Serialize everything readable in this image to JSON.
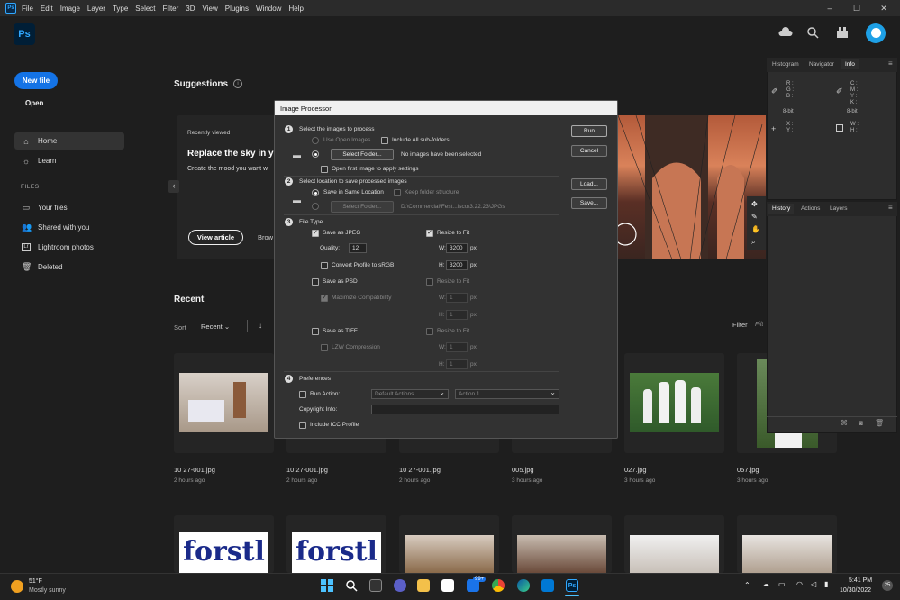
{
  "menubar": {
    "app_icon": "Ps",
    "items": [
      "File",
      "Edit",
      "Image",
      "Layer",
      "Type",
      "Select",
      "Filter",
      "3D",
      "View",
      "Plugins",
      "Window",
      "Help"
    ],
    "minimize": "–",
    "maximize": "☐",
    "close": "✕"
  },
  "topbar": {
    "logo": "Ps",
    "cloud_icon": "cloud-icon",
    "search_icon": "search-icon",
    "plugins_icon": "plugins-icon"
  },
  "sidebar": {
    "new_file": "New file",
    "open": "Open",
    "home": "Home",
    "learn": "Learn",
    "files_header": "FILES",
    "your_files": "Your files",
    "shared": "Shared with you",
    "lightroom": "Lightroom photos",
    "deleted": "Deleted"
  },
  "suggestions": {
    "title": "Suggestions",
    "recently_viewed": "Recently viewed",
    "headline": "Replace the sky in yo",
    "desc": "Create the mood you want w",
    "view_article": "View article",
    "browse": "Brow"
  },
  "recent": {
    "title": "Recent",
    "sort_label": "Sort",
    "sort_value": "Recent",
    "filter_label": "Filter",
    "filter_placeholder": "Filt",
    "items": [
      {
        "name": "10 27-001.jpg",
        "time": "2 hours ago"
      },
      {
        "name": "10 27-001.jpg",
        "time": "2 hours ago"
      },
      {
        "name": "10 27-001.jpg",
        "time": "2 hours ago"
      },
      {
        "name": "005.jpg",
        "time": "3 hours ago"
      },
      {
        "name": "027.jpg",
        "time": "3 hours ago"
      },
      {
        "name": "057.jpg",
        "time": "3 hours ago"
      }
    ],
    "row2_text": "forstl"
  },
  "info_panel": {
    "tabs": [
      "Histogram",
      "Navigator",
      "Info"
    ],
    "rgb": "R :\nG :\nB :",
    "cmyk": "C :\nM :\nY :\nK :",
    "bit1": "8-bit",
    "bit2": "8-bit",
    "xy": "X :\nY :",
    "wh": "W :\nH :"
  },
  "history_panel": {
    "tabs": [
      "History",
      "Actions",
      "Layers"
    ]
  },
  "dialog": {
    "title": "Image Processor",
    "s1": "Select the images to process",
    "use_open": "Use Open Images",
    "include_sub": "Include All sub-folders",
    "select_folder": "Select Folder...",
    "no_images": "No images have been selected",
    "open_first": "Open first image to apply settings",
    "s2": "Select location to save processed images",
    "save_same": "Save in Same Location",
    "keep_structure": "Keep folder structure",
    "select_folder2": "Select Folder...",
    "path": "D:\\Commercial\\Fest...lsco\\3.22.23\\JPGs",
    "s3": "File Type",
    "save_jpeg": "Save as JPEG",
    "resize_fit": "Resize to Fit",
    "quality_label": "Quality:",
    "quality_value": "12",
    "w_label": "W:",
    "h_label": "H:",
    "w_value": "3200",
    "h_value": "3200",
    "px": "px",
    "convert_srgb": "Convert Profile to sRGB",
    "save_psd": "Save as PSD",
    "maximize_compat": "Maximize Compatibility",
    "psd_w": "1",
    "psd_h": "1",
    "save_tiff": "Save as TIFF",
    "lzw": "LZW Compression",
    "tiff_w": "1",
    "tiff_h": "1",
    "s4": "Preferences",
    "run_action": "Run Action:",
    "default_actions": "Default Actions",
    "action1": "Action 1",
    "copyright": "Copyright Info:",
    "include_icc": "Include ICC Profile",
    "run": "Run",
    "cancel": "Cancel",
    "load": "Load...",
    "save": "Save...",
    "n1": "1",
    "n2": "2",
    "n3": "3",
    "n4": "4"
  },
  "taskbar": {
    "weather_temp": "51°F",
    "weather_desc": "Mostly sunny",
    "time": "5:41 PM",
    "date": "10/30/2022",
    "mail_badge": "99+",
    "notif": "25"
  },
  "colors": {
    "accent": "#1473e6",
    "ps_blue": "#31a8ff",
    "bg": "#1e1e1e",
    "dialog": "#323232"
  }
}
